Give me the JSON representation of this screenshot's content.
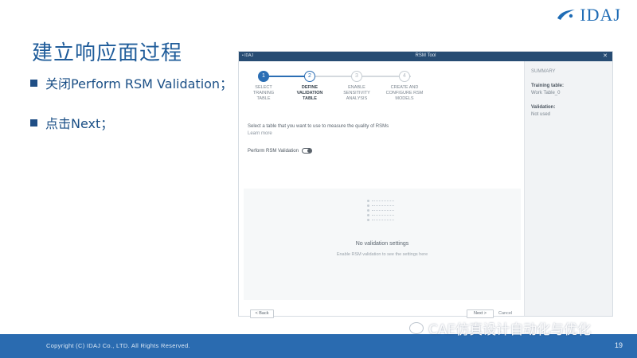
{
  "slide": {
    "title": "建立响应面过程",
    "bullets": [
      "关闭Perform RSM Validation；",
      "点击Next；"
    ],
    "logo_text": "IDAJ",
    "page_number": "19",
    "copyright": "Copyright (C) IDAJ Co., LTD. All Rights Reserved.",
    "watermark": "CAE仿真设计自动化与优化"
  },
  "app": {
    "logo": "• IDAJ",
    "title": "RSM Tool",
    "close": "✕",
    "steps": [
      {
        "num": "1",
        "label": "SELECT\nTRAINING\nTABLE",
        "state": "active"
      },
      {
        "num": "2",
        "label": "DEFINE\nVALIDATION\nTABLE",
        "state": "current"
      },
      {
        "num": "3",
        "label": "ENABLE\nSENSITIVITY\nANALYSIS",
        "state": "todo"
      },
      {
        "num": "4",
        "label": "CREATE AND\nCONFIGURE RSM\nMODELS",
        "state": "todo"
      }
    ],
    "description": "Select a table that you want to use to measure the quality of RSMs",
    "learn_more": "Learn more",
    "toggle_label": "Perform RSM Validation",
    "toggle_on": false,
    "empty_title": "No validation settings",
    "empty_subtitle": "Enable RSM validation to see the settings here",
    "back_label": "< Back",
    "next_label": "Next >",
    "cancel_label": "Cancel",
    "summary": {
      "title": "SUMMARY",
      "training_label": "Training table:",
      "training_value": "Work Table_0",
      "validation_label": "Validation:",
      "validation_value": "Not used"
    }
  }
}
